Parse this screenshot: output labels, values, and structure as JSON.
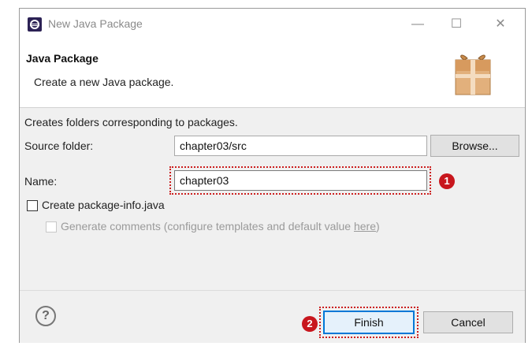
{
  "window": {
    "title": "New Java Package",
    "minimize_glyph": "—",
    "maximize_glyph": "☐",
    "close_glyph": "✕"
  },
  "header": {
    "title": "Java Package",
    "description": "Create a new Java package."
  },
  "form": {
    "info_text": "Creates folders corresponding to packages.",
    "source_folder_label": "Source folder:",
    "source_folder_value": "chapter03/src",
    "browse_label": "Browse...",
    "name_label": "Name:",
    "name_value": "chapter03",
    "create_package_info_label": "Create package-info.java",
    "create_package_info_checked": false,
    "generate_comments_label": "Generate comments (configure templates and default value ",
    "generate_comments_link": "here",
    "generate_comments_suffix": ")",
    "generate_comments_checked": false
  },
  "annotations": {
    "marker_1": "❶",
    "marker_2": "❷"
  },
  "footer": {
    "help_glyph": "?",
    "finish_label": "Finish",
    "cancel_label": "Cancel"
  },
  "colors": {
    "annotation_red": "#c8161d",
    "focus_blue": "#0078d7"
  }
}
